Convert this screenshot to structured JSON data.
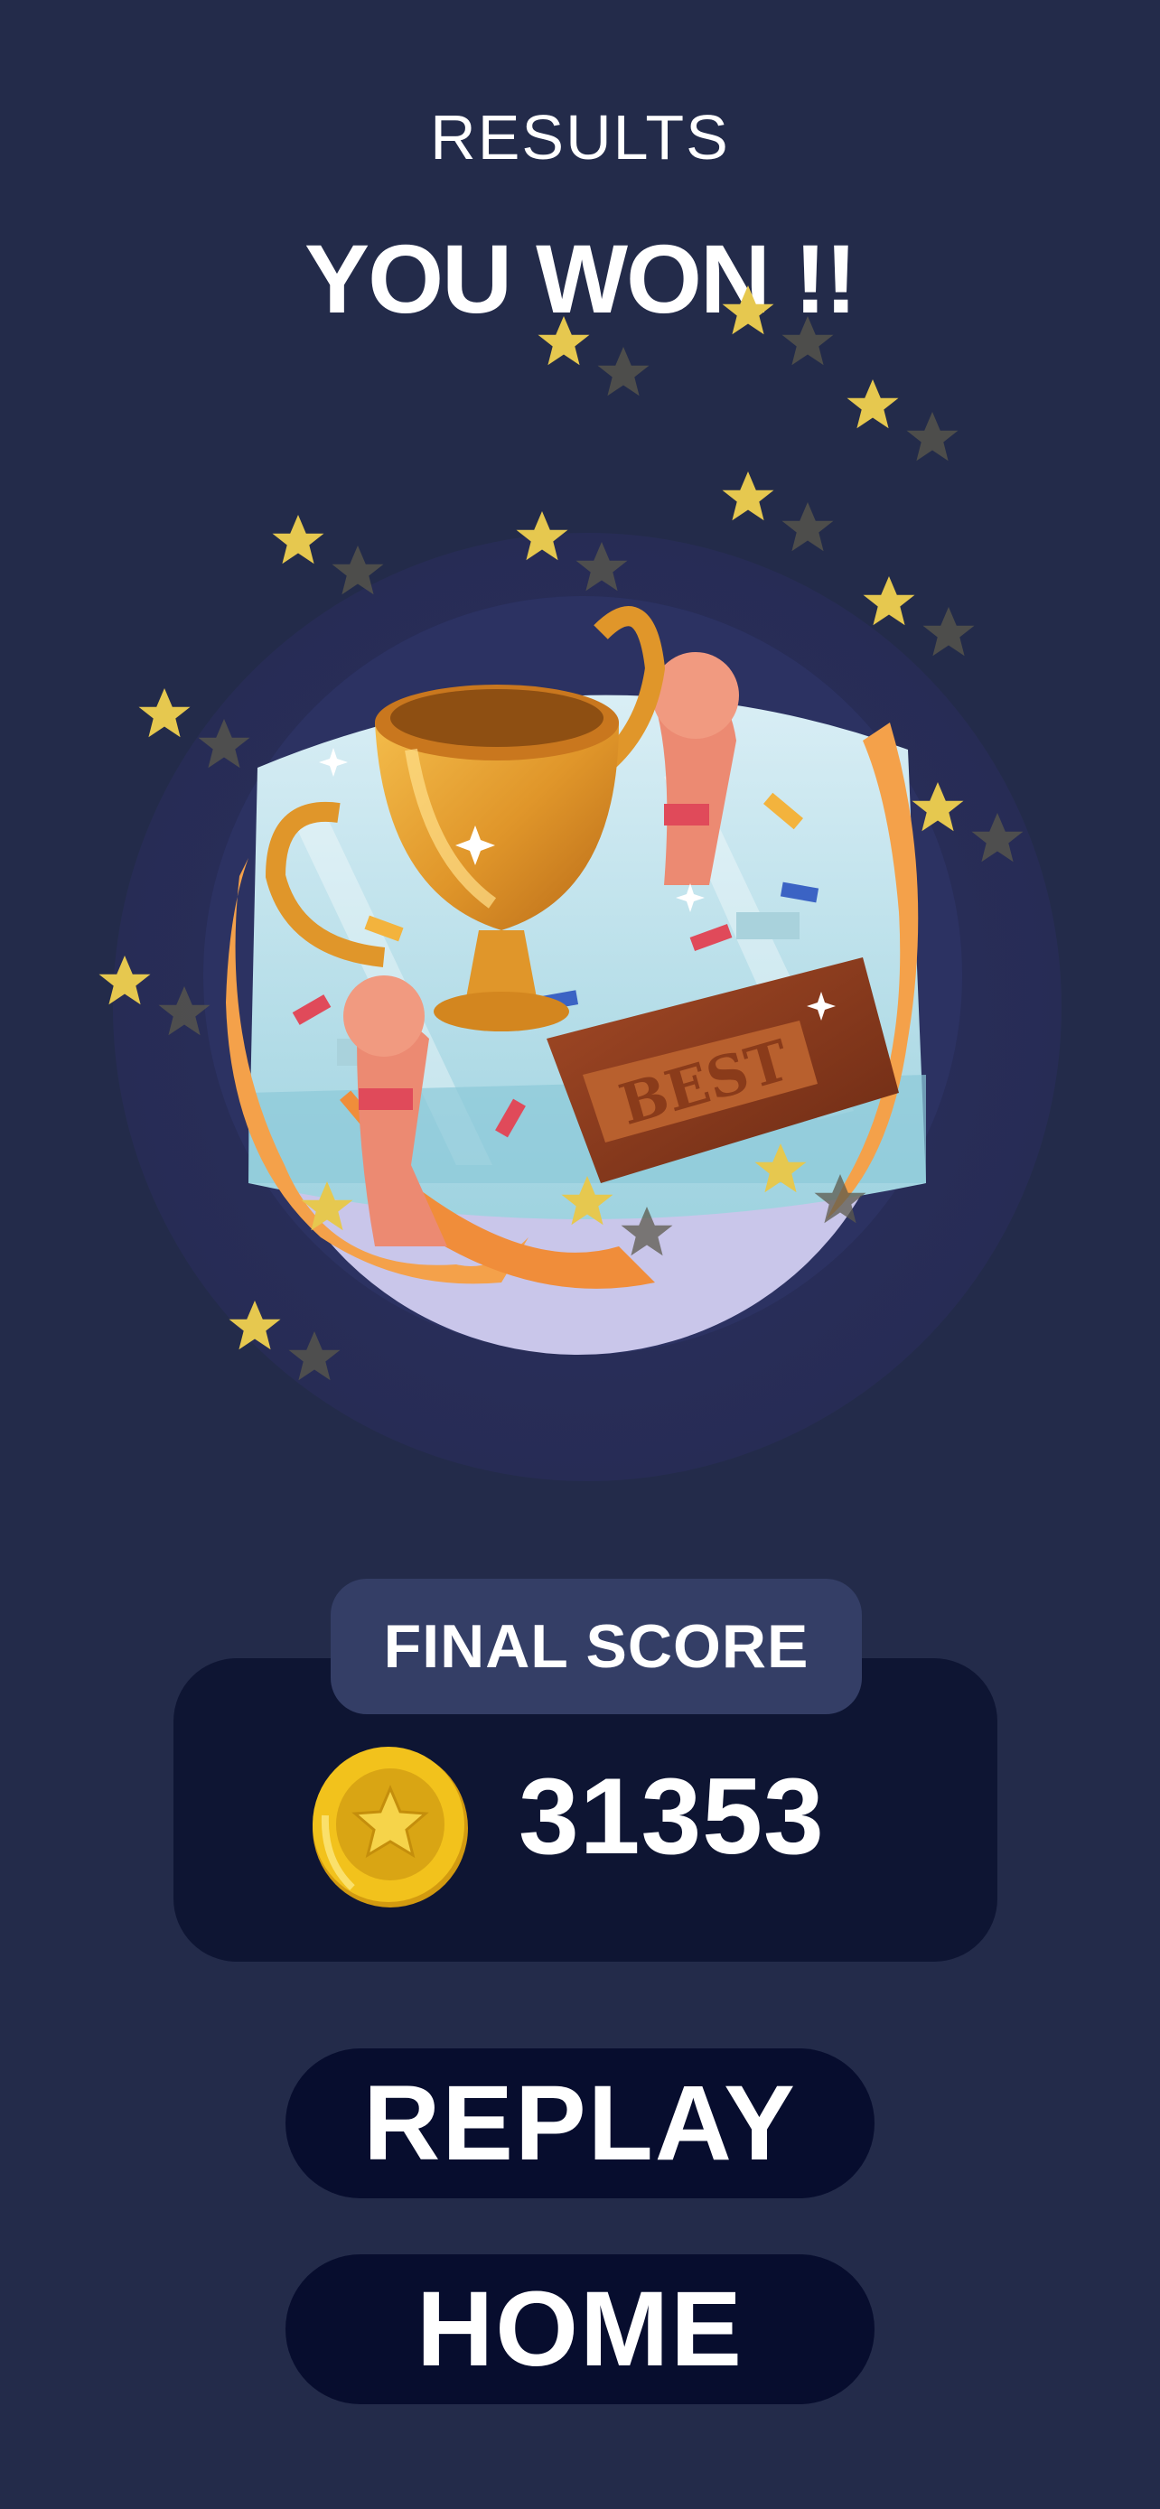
{
  "header": {
    "title": "RESULTS"
  },
  "result": {
    "headline": "YOU WON !!"
  },
  "trophy": {
    "banner_text": "BEST"
  },
  "score": {
    "label": "FINAL SCORE",
    "value": "31353",
    "icon": "coin-icon"
  },
  "buttons": {
    "replay": "REPLAY",
    "home": "HOME"
  },
  "colors": {
    "background": "#232b4a",
    "card": "#0e1533",
    "label_box": "#343e66",
    "button": "#070d2e",
    "star": "#e6c84f"
  }
}
